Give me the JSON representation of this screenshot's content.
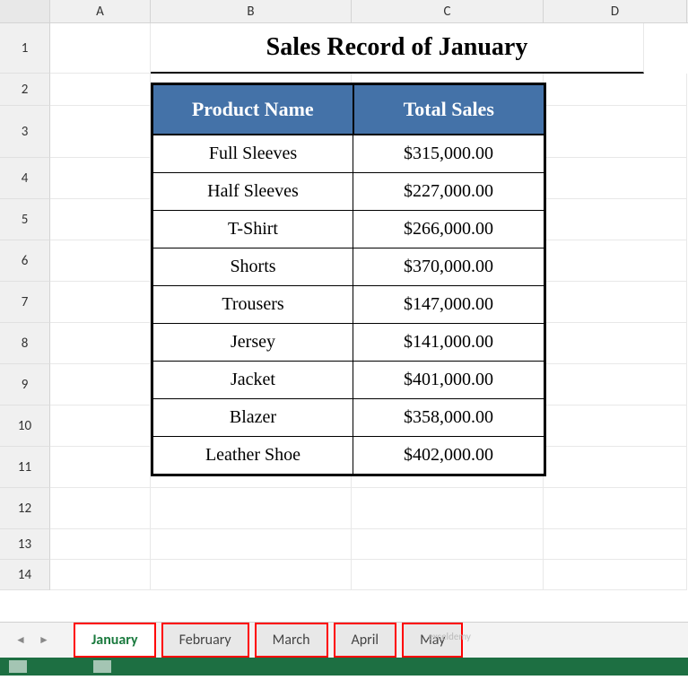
{
  "columns": [
    "A",
    "B",
    "C",
    "D"
  ],
  "rows": [
    "1",
    "2",
    "3",
    "4",
    "5",
    "6",
    "7",
    "8",
    "9",
    "10",
    "11",
    "12",
    "13",
    "14"
  ],
  "title": "Sales Record of January",
  "table": {
    "headers": {
      "product": "Product Name",
      "sales": "Total Sales"
    },
    "rows": [
      {
        "product": "Full Sleeves",
        "sales": "$315,000.00"
      },
      {
        "product": "Half Sleeves",
        "sales": "$227,000.00"
      },
      {
        "product": "T-Shirt",
        "sales": "$266,000.00"
      },
      {
        "product": "Shorts",
        "sales": "$370,000.00"
      },
      {
        "product": "Trousers",
        "sales": "$147,000.00"
      },
      {
        "product": "Jersey",
        "sales": "$141,000.00"
      },
      {
        "product": "Jacket",
        "sales": "$401,000.00"
      },
      {
        "product": "Blazer",
        "sales": "$358,000.00"
      },
      {
        "product": "Leather Shoe",
        "sales": "$402,000.00"
      }
    ]
  },
  "sheet_tabs": [
    {
      "name": "January",
      "active": true
    },
    {
      "name": "February",
      "active": false
    },
    {
      "name": "March",
      "active": false
    },
    {
      "name": "April",
      "active": false
    },
    {
      "name": "May",
      "active": false
    }
  ],
  "watermark": "exceldemy"
}
